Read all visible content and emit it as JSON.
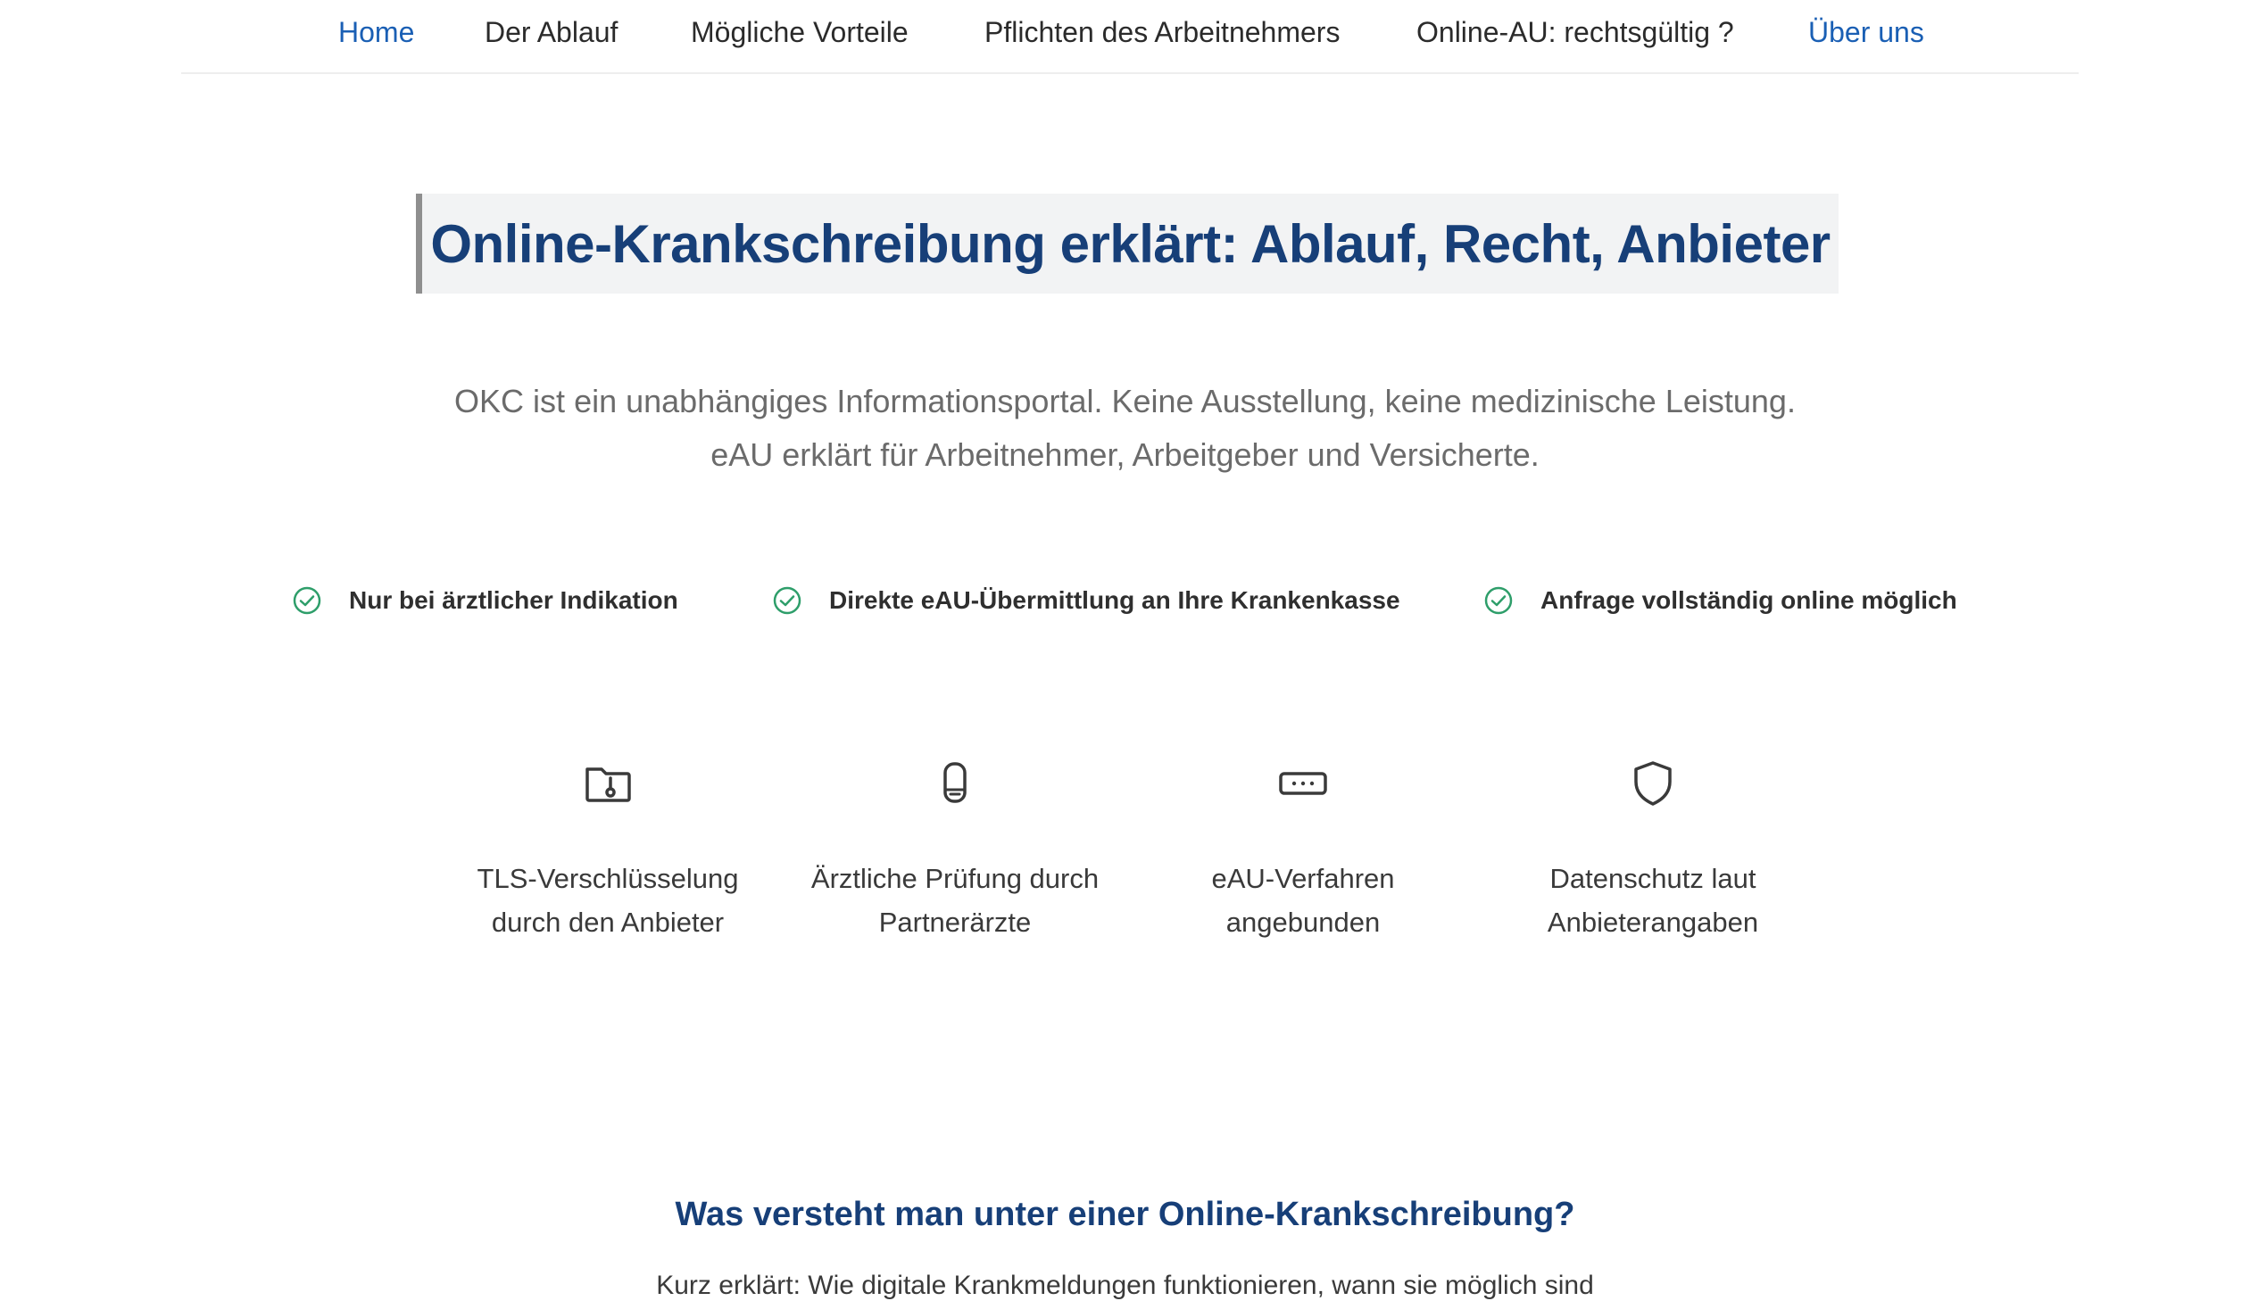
{
  "nav": {
    "items": [
      {
        "label": "Home"
      },
      {
        "label": "Der Ablauf"
      },
      {
        "label": "Mögliche Vorteile"
      },
      {
        "label": "Pflichten des Arbeitnehmers"
      },
      {
        "label": "Online-AU: rechtsgültig ?"
      },
      {
        "label": "Über uns"
      }
    ]
  },
  "hero": {
    "title": "Online-Krankschreibung erklärt: Ablauf, Recht, Anbieter",
    "intro_line1": "OKC ist ein unabhängiges Informationsportal. Keine Ausstellung, keine medizinische Leistung.",
    "intro_line2": "eAU erklärt für Arbeitnehmer, Arbeitgeber und Versicherte."
  },
  "checks": [
    {
      "icon": "check-circle-icon",
      "label": "Nur bei ärztlicher Indikation"
    },
    {
      "icon": "check-circle-icon",
      "label": "Direkte eAU-Übermittlung an Ihre Krankenkasse"
    },
    {
      "icon": "check-circle-icon",
      "label": "Anfrage vollständig online möglich"
    }
  ],
  "features": [
    {
      "icon": "folder-lock-icon",
      "label": "TLS-Verschlüsselung\ndurch den Anbieter"
    },
    {
      "icon": "phone-icon",
      "label": "Ärztliche Prüfung durch\nPartnerärzte"
    },
    {
      "icon": "transfer-icon",
      "label": "eAU-Verfahren\nangebunden"
    },
    {
      "icon": "shield-icon",
      "label": "Datenschutz laut\nAnbieterangaben"
    }
  ],
  "section": {
    "title": "Was versteht man unter einer Online-Krankschreibung?",
    "subtitle": "Kurz erklärt: Wie digitale Krankmeldungen funktionieren, wann sie möglich sind"
  },
  "colors": {
    "accent": "#1a5fb4",
    "heading": "#173f78",
    "check": "#2e9e6a"
  }
}
